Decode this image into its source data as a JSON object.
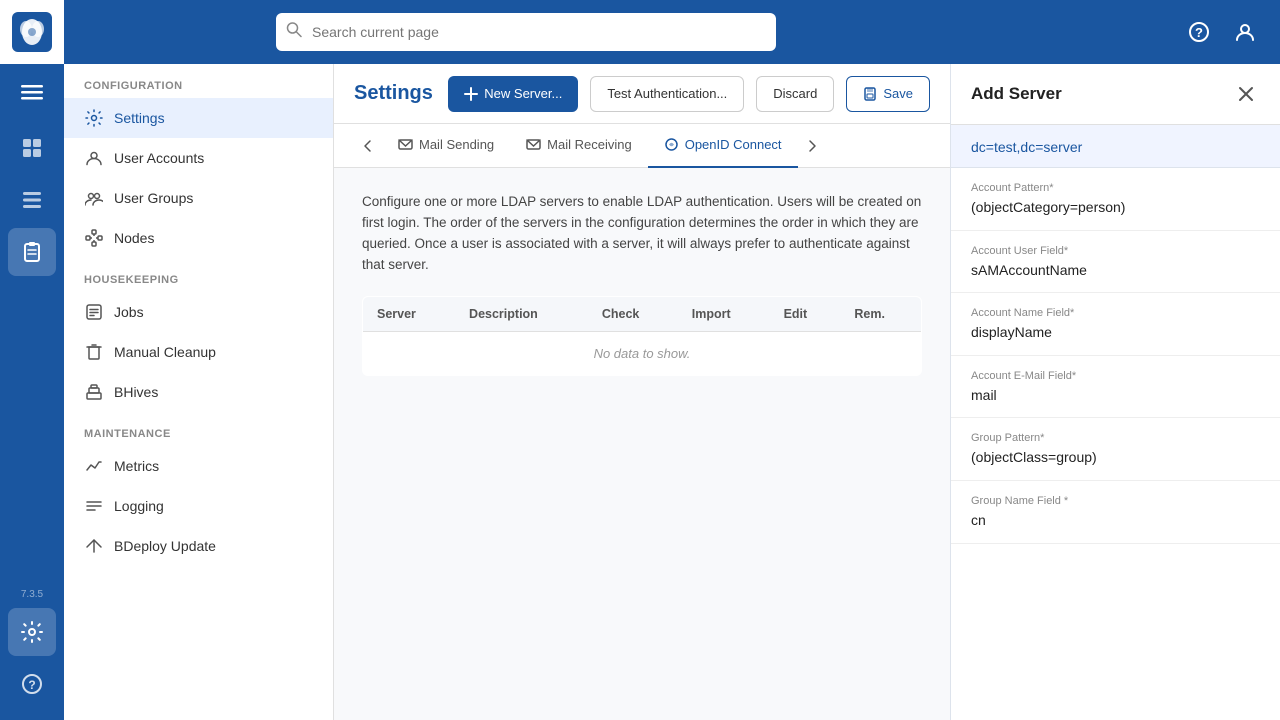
{
  "app": {
    "version": "7.3.5",
    "logo_alt": "BeeHive Logo"
  },
  "topbar": {
    "search_placeholder": "Search current page",
    "help_icon": "help-icon",
    "user_icon": "user-icon"
  },
  "sidebar": {
    "configuration_label": "Configuration",
    "housekeeping_label": "Housekeeping",
    "maintenance_label": "Maintenance",
    "items": [
      {
        "id": "settings",
        "label": "Settings",
        "icon": "settings-icon",
        "active": true
      },
      {
        "id": "user-accounts",
        "label": "User Accounts",
        "icon": "user-accounts-icon",
        "active": false
      },
      {
        "id": "user-groups",
        "label": "User Groups",
        "icon": "user-groups-icon",
        "active": false
      },
      {
        "id": "nodes",
        "label": "Nodes",
        "icon": "nodes-icon",
        "active": false
      },
      {
        "id": "jobs",
        "label": "Jobs",
        "icon": "jobs-icon",
        "active": false
      },
      {
        "id": "manual-cleanup",
        "label": "Manual Cleanup",
        "icon": "cleanup-icon",
        "active": false
      },
      {
        "id": "bhives",
        "label": "BHives",
        "icon": "bhives-icon",
        "active": false
      },
      {
        "id": "metrics",
        "label": "Metrics",
        "icon": "metrics-icon",
        "active": false
      },
      {
        "id": "logging",
        "label": "Logging",
        "icon": "logging-icon",
        "active": false
      },
      {
        "id": "bdeploy-update",
        "label": "BDeploy Update",
        "icon": "update-icon",
        "active": false
      }
    ]
  },
  "main": {
    "page_title": "Settings",
    "buttons": {
      "new_server": "New Server...",
      "test_auth": "Test Authentication...",
      "discard": "Discard",
      "save": "Save"
    },
    "tabs": [
      {
        "id": "mail-sending",
        "label": "Mail Sending",
        "icon": "mail-sending-icon",
        "active": false
      },
      {
        "id": "mail-receiving",
        "label": "Mail Receiving",
        "icon": "mail-receiving-icon",
        "active": false
      },
      {
        "id": "openid-connect",
        "label": "OpenID Connect",
        "icon": "openid-icon",
        "active": false
      }
    ],
    "description": "Configure one or more LDAP servers to enable LDAP authentication. Users will be created on first login. The order of the servers in the configuration determines the order in which they are queried. Once a user is associated with a server, it will always prefer to authenticate against that server.",
    "table": {
      "columns": [
        "Server",
        "Description",
        "Check",
        "Import",
        "Edit",
        "Rem."
      ],
      "no_data_text": "No data to show."
    }
  },
  "add_server_panel": {
    "title": "Add Server",
    "fields": [
      {
        "id": "server-url",
        "label": "dc=test,dc=server",
        "value": "",
        "is_top_input": true
      },
      {
        "id": "account-pattern",
        "label": "Account Pattern*",
        "value": "(objectCategory=person)"
      },
      {
        "id": "account-user-field",
        "label": "Account User Field*",
        "value": "sAMAccountName"
      },
      {
        "id": "account-name-field",
        "label": "Account Name Field*",
        "value": "displayName"
      },
      {
        "id": "account-email-field",
        "label": "Account E-Mail Field*",
        "value": "mail"
      },
      {
        "id": "group-pattern",
        "label": "Group Pattern*",
        "value": "(objectClass=group)"
      },
      {
        "id": "group-name-field",
        "label": "Group Name Field *",
        "value": "cn"
      }
    ]
  }
}
